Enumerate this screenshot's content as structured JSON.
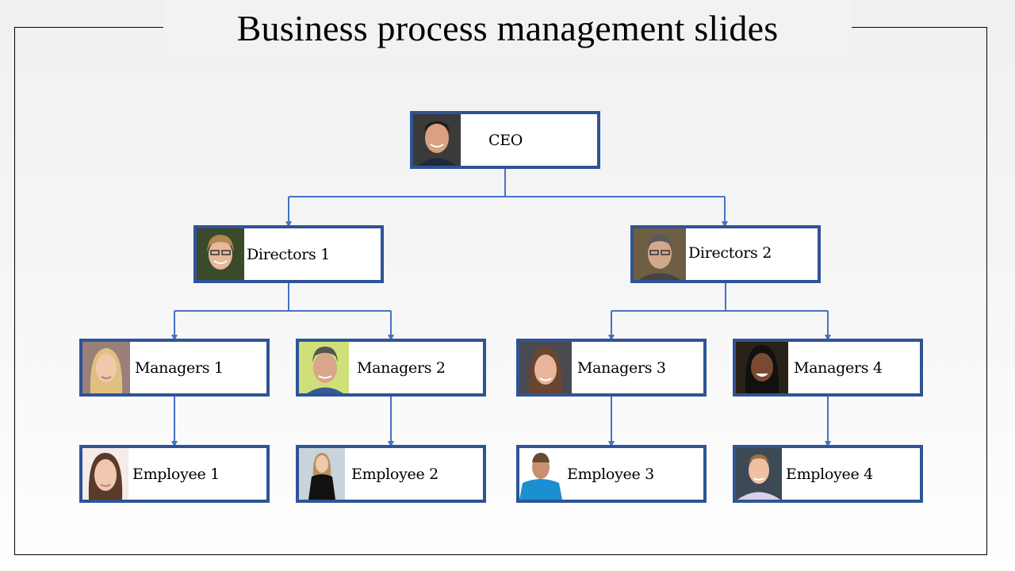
{
  "slide": {
    "title": "Business process management slides"
  },
  "colors": {
    "box_border": "#2f5496",
    "connector": "#4472c4",
    "frame": "#000000"
  },
  "org_chart": {
    "ceo": {
      "label": "CEO",
      "icon": "person-photo"
    },
    "directors": [
      {
        "label": "Directors 1",
        "icon": "person-photo"
      },
      {
        "label": "Directors 2",
        "icon": "person-photo"
      }
    ],
    "managers": [
      {
        "label": "Managers 1",
        "reports_to": "Directors 1",
        "icon": "person-photo"
      },
      {
        "label": "Managers 2",
        "reports_to": "Directors 1",
        "icon": "person-photo"
      },
      {
        "label": "Managers 3",
        "reports_to": "Directors 2",
        "icon": "person-photo"
      },
      {
        "label": "Managers 4",
        "reports_to": "Directors 2",
        "icon": "person-photo"
      }
    ],
    "employees": [
      {
        "label": "Employee 1",
        "reports_to": "Managers 1",
        "icon": "person-photo"
      },
      {
        "label": "Employee 2",
        "reports_to": "Managers 2",
        "icon": "person-photo"
      },
      {
        "label": "Employee 3",
        "reports_to": "Managers 3",
        "icon": "person-photo"
      },
      {
        "label": "Employee 4",
        "reports_to": "Managers 4",
        "icon": "person-photo"
      }
    ]
  }
}
